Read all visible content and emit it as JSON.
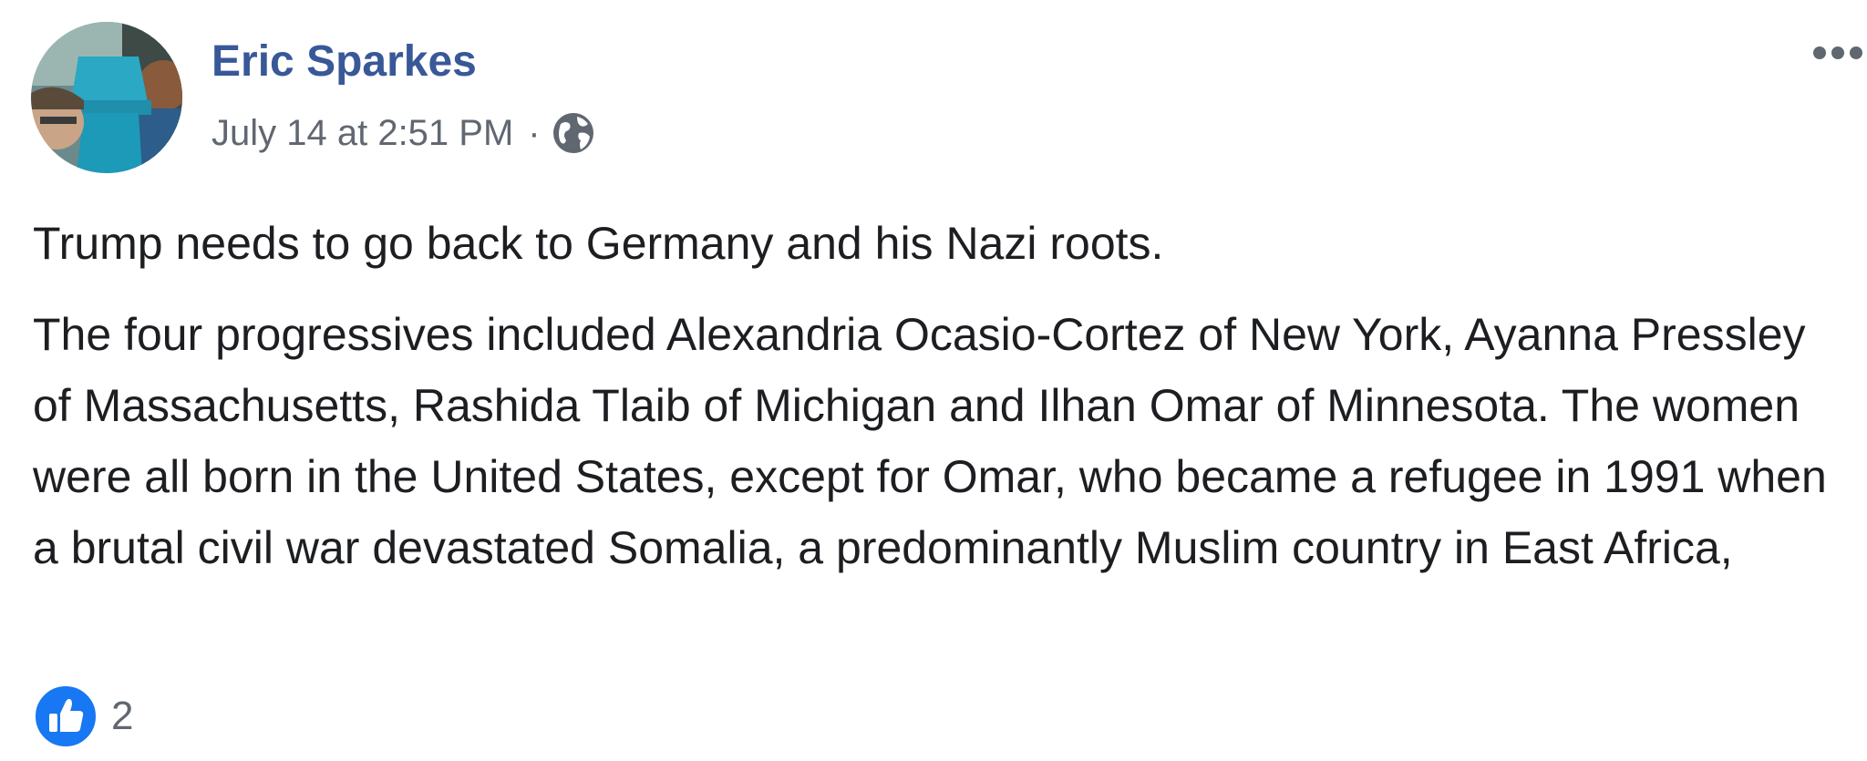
{
  "post": {
    "author": {
      "name": "Eric Sparkes",
      "avatar_icon": "profile-photo"
    },
    "timestamp": "July 14 at 2:51 PM",
    "separator": "·",
    "audience_icon": "globe-icon",
    "more_icon": "ellipsis-icon",
    "text": {
      "line1": "Trump needs to go back to Germany and his Nazi roots.",
      "paragraph2": "The four progressives included Alexandria Ocasio-Cortez of New York, Ayanna Pressley of Massachusetts, Rashida Tlaib of Michigan and Ilhan Omar of Minnesota. The women were all born in the United States, except for Omar, who became a refugee in 1991 when a brutal civil war devastated Somalia, a predominantly Muslim country in East Africa,"
    },
    "reactions": {
      "icon": "like-icon",
      "count": "2"
    }
  },
  "colors": {
    "author_name": "#385898",
    "meta_text": "#616770",
    "body_text": "#1c1e21",
    "like_blue": "#1877f2"
  }
}
